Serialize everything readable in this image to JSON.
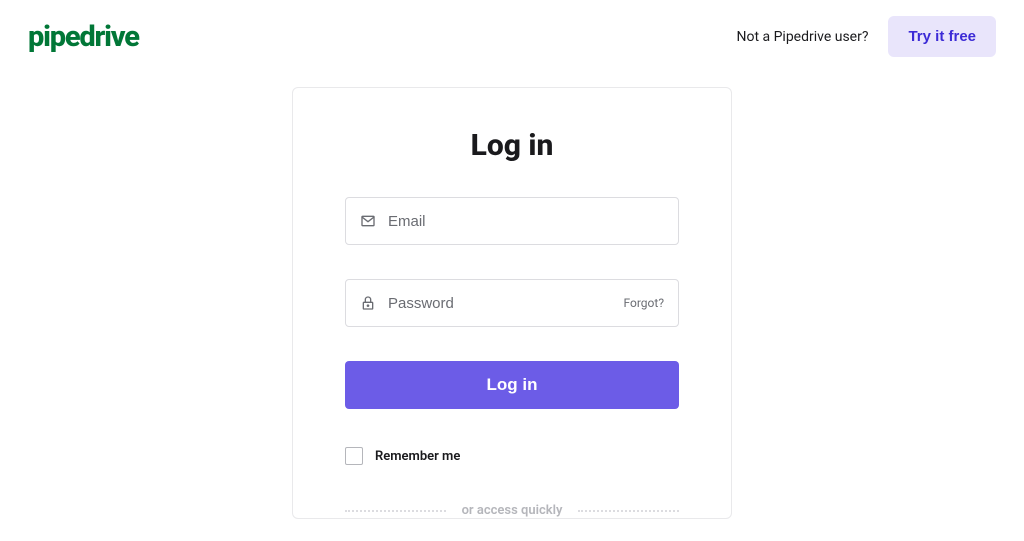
{
  "header": {
    "logo": "pipedrive",
    "not_user_text": "Not a Pipedrive user?",
    "try_free_label": "Try it free"
  },
  "card": {
    "title": "Log in",
    "email_placeholder": "Email",
    "password_placeholder": "Password",
    "forgot_label": "Forgot?",
    "login_button_label": "Log in",
    "remember_label": "Remember me",
    "divider_text": "or access quickly"
  },
  "colors": {
    "brand_green": "#017737",
    "primary_purple": "#6C5CE7",
    "light_purple": "#e9e5fb",
    "purple_text": "#3c2bd6"
  }
}
